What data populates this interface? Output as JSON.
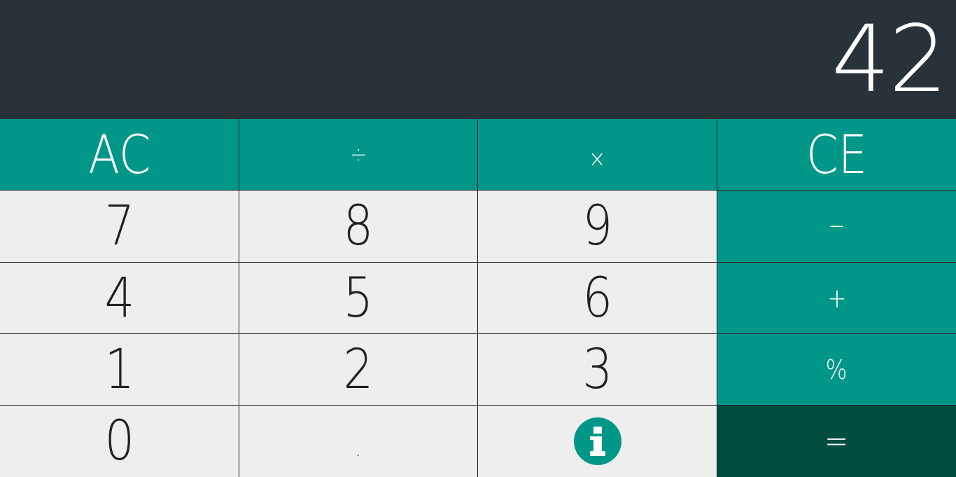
{
  "display": {
    "value": "42"
  },
  "keys": {
    "ac": "AC",
    "divide": "÷",
    "multiply": "×",
    "ce": "CE",
    "seven": "7",
    "eight": "8",
    "nine": "9",
    "minus": "−",
    "four": "4",
    "five": "5",
    "six": "6",
    "plus": "+",
    "one": "1",
    "two": "2",
    "three": "3",
    "percent": "%",
    "zero": "0",
    "decimal": ".",
    "info_icon": "info-icon",
    "equals": "="
  },
  "colors": {
    "display_bg": "#283238",
    "operator_bg": "#009688",
    "equals_bg": "#004d40",
    "digit_bg": "#eeeeee",
    "info_icon": "#009688"
  }
}
